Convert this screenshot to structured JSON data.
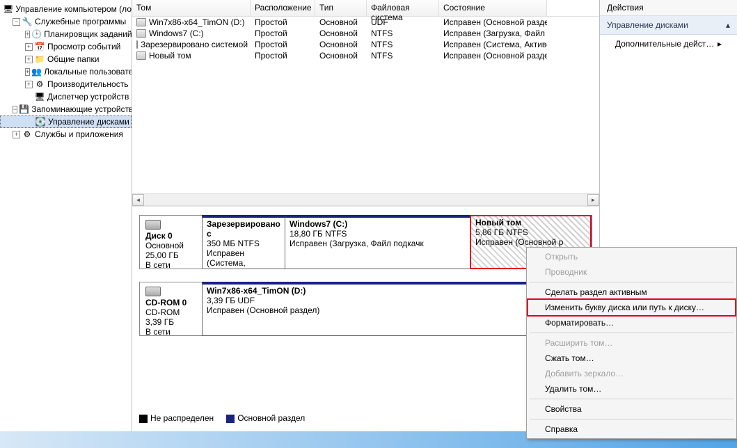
{
  "tree": {
    "root": "Управление компьютером (ло",
    "system_tools": "Служебные программы",
    "task_scheduler": "Планировщик заданий",
    "event_viewer": "Просмотр событий",
    "shared_folders": "Общие папки",
    "local_users": "Локальные пользовате",
    "performance": "Производительность",
    "device_manager": "Диспетчер устройств",
    "storage": "Запоминающие устройства",
    "disk_management": "Управление дисками",
    "services": "Службы и приложения"
  },
  "columns": {
    "vol": "Том",
    "layout": "Расположение",
    "type": "Тип",
    "fs": "Файловая система",
    "status": "Состояние"
  },
  "rows": [
    {
      "vol": "Win7x86-x64_TimON (D:)",
      "layout": "Простой",
      "type": "Основной",
      "fs": "UDF",
      "status": "Исправен (Основной раздел"
    },
    {
      "vol": "Windows7 (C:)",
      "layout": "Простой",
      "type": "Основной",
      "fs": "NTFS",
      "status": "Исправен (Загрузка, Файл по"
    },
    {
      "vol": "Зарезервировано системой",
      "layout": "Простой",
      "type": "Основной",
      "fs": "NTFS",
      "status": "Исправен (Система, Активен"
    },
    {
      "vol": "Новый том",
      "layout": "Простой",
      "type": "Основной",
      "fs": "NTFS",
      "status": "Исправен (Основной раздел"
    }
  ],
  "disks": {
    "disk0": {
      "name": "Диск 0",
      "type": "Основной",
      "size": "25,00 ГБ",
      "state": "В сети"
    },
    "cdrom": {
      "name": "CD-ROM 0",
      "type": "CD-ROM",
      "size": "3,39 ГБ",
      "state": "В сети"
    }
  },
  "parts": {
    "p0_0": {
      "name": "Зарезервировано с",
      "size": "350 МБ NTFS",
      "status": "Исправен (Система,"
    },
    "p0_1": {
      "name": "Windows7  (C:)",
      "size": "18,80 ГБ NTFS",
      "status": "Исправен (Загрузка, Файл подкачк"
    },
    "p0_2": {
      "name": "Новый том",
      "size": "5,86 ГБ NTFS",
      "status": "Исправен (Основной р"
    },
    "p1_0": {
      "name": "Win7x86-x64_TimON (D:)",
      "size": "3,39 ГБ UDF",
      "status": "Исправен (Основной раздел)"
    }
  },
  "legend": {
    "unalloc": "Не распределен",
    "primary": "Основной раздел"
  },
  "actions": {
    "header": "Действия",
    "category": "Управление дисками",
    "more": "Дополнительные дейст…"
  },
  "ctx": {
    "open": "Открыть",
    "explorer": "Проводник",
    "make_active": "Сделать раздел активным",
    "change_letter": "Изменить букву диска или путь к диску…",
    "format": "Форматировать…",
    "extend": "Расширить том…",
    "shrink": "Сжать том…",
    "mirror": "Добавить зеркало…",
    "delete": "Удалить том…",
    "properties": "Свойства",
    "help": "Справка"
  }
}
